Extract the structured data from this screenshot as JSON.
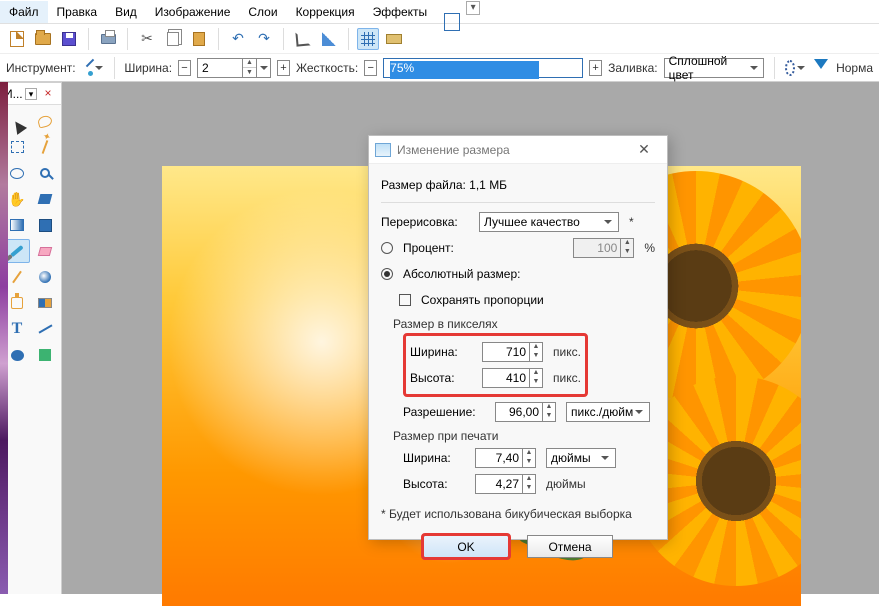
{
  "menu": {
    "file": "Файл",
    "edit": "Правка",
    "view": "Вид",
    "image": "Изображение",
    "layers": "Слои",
    "adjust": "Коррекция",
    "effects": "Эффекты"
  },
  "toolbar2": {
    "tool_label": "Инструмент:",
    "width_label": "Ширина:",
    "width_value": "2",
    "hardness_label": "Жесткость:",
    "hardness_value": "75%",
    "fill_label": "Заливка:",
    "fill_select": "Сплошной цвет",
    "mode_label": "Норма"
  },
  "toolbox": {
    "title": "И..."
  },
  "dialog": {
    "title": "Изменение размера",
    "filesize_label": "Размер файла: 1,1 МБ",
    "resample_label": "Перерисовка:",
    "resample_value": "Лучшее качество",
    "percent_label": "Процент:",
    "percent_value": "100",
    "percent_suffix": "%",
    "abs_label": "Абсолютный размер:",
    "keep_aspect": "Сохранять пропорции",
    "pixel_group": "Размер в пикселях",
    "width_label": "Ширина:",
    "height_label": "Высота:",
    "px_width": "710",
    "px_height": "410",
    "px_suffix": "пикс.",
    "res_label": "Разрешение:",
    "res_value": "96,00",
    "res_unit": "пикс./дюйм",
    "print_group": "Размер при печати",
    "print_width": "7,40",
    "print_height": "4,27",
    "print_unit": "дюймы",
    "footnote": "* Будет использована бикубическая выборка",
    "ok": "OK",
    "cancel": "Отмена"
  }
}
